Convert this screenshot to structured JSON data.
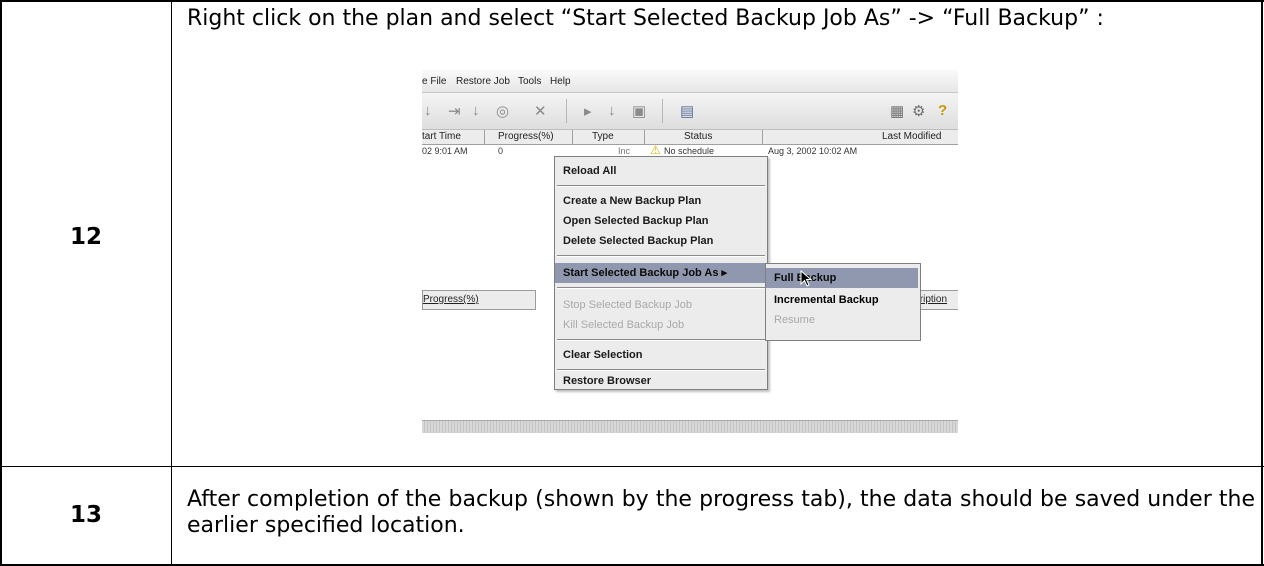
{
  "rows": [
    {
      "step": "12",
      "instruction": "Right click on the plan and select “Start Selected Backup Job As” -> “Full Backup” :"
    },
    {
      "step": "13",
      "instruction": "After completion of the backup (shown by the progress tab), the data should be saved under the earlier specified location."
    }
  ],
  "screenshot": {
    "menubar": [
      "e File",
      "Restore Job",
      "Tools",
      "Help"
    ],
    "columns": [
      "tart Time",
      "Progress(%)",
      "Type",
      "Status",
      "Last Modified"
    ],
    "row": {
      "start_time": "02 9:01 AM",
      "progress": "0",
      "type": "Inc",
      "status": "No schedule",
      "last_modified": "Aug 3, 2002 10:02 AM"
    },
    "bottom_columns": [
      "Progress(%)",
      "Description"
    ],
    "context_menu": {
      "reload_all": "Reload All",
      "create_plan": "Create a New Backup Plan",
      "open_plan": "Open Selected Backup Plan",
      "delete_plan": "Delete Selected Backup Plan",
      "start_as": "Start Selected Backup Job As ▸",
      "stop_job": "Stop Selected Backup Job",
      "kill_job": "Kill Selected Backup Job",
      "clear_selection": "Clear Selection",
      "restore_browser": "Restore Browser"
    },
    "submenu": {
      "full_backup": "Full Backup",
      "incremental_backup": "Incremental Backup",
      "resume": "Resume"
    },
    "highlight_color": "#8f98ae",
    "warning_color": "#f2c200"
  }
}
